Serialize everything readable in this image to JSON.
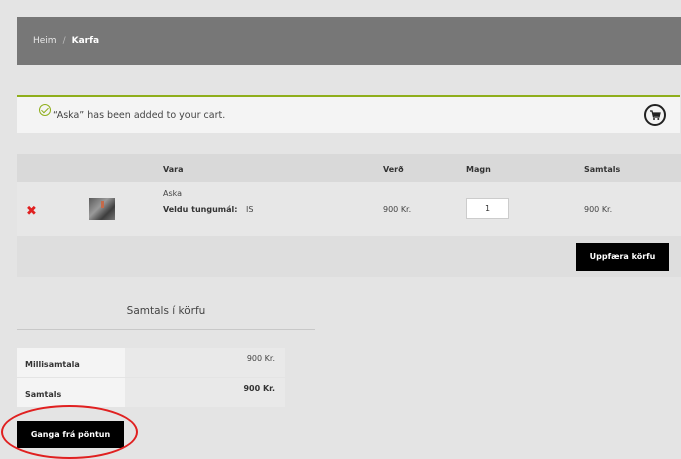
{
  "breadcrumb": {
    "home": "Heim",
    "separator": "/",
    "current": "Karfa"
  },
  "notice": {
    "text": "“Aska” has been added to your cart.",
    "icon": "check-circle-icon"
  },
  "cart": {
    "icon": "cart-icon",
    "headers": {
      "product": "Vara",
      "price": "Verð",
      "quantity": "Magn",
      "subtotal": "Samtals"
    },
    "items": [
      {
        "name": "Aska",
        "variation_label": "Veldu tungumál:",
        "variation_value": "IS",
        "price": "900 Kr.",
        "quantity": "1",
        "subtotal": "900 Kr."
      }
    ],
    "update_label": "Uppfæra körfu"
  },
  "totals": {
    "title": "Samtals í körfu",
    "subtotal_label": "Millisamtala",
    "subtotal_value": "900 Kr.",
    "total_label": "Samtals",
    "total_value": "900 Kr."
  },
  "checkout_label": "Ganga frá pöntun",
  "colors": {
    "accent_green": "#8fae1b",
    "remove_red": "#e02020",
    "button_black": "#000000",
    "header_gray": "#777777"
  }
}
